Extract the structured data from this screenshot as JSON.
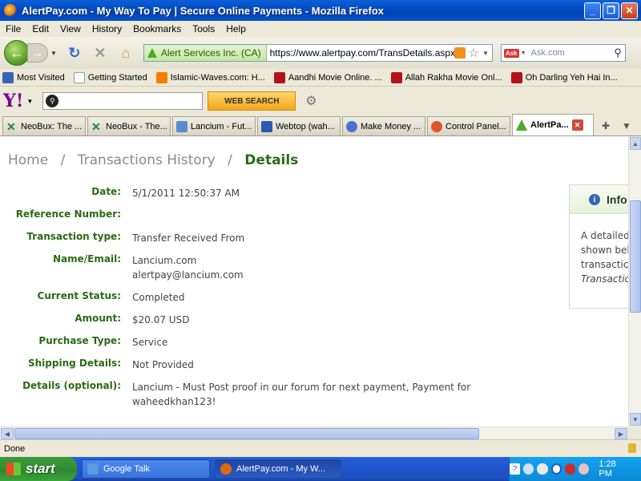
{
  "window": {
    "title": "AlertPay.com - My Way To Pay | Secure Online Payments - Mozilla Firefox"
  },
  "menu": [
    "File",
    "Edit",
    "View",
    "History",
    "Bookmarks",
    "Tools",
    "Help"
  ],
  "nav": {
    "site_identity": "Alert Services Inc. (CA)",
    "url": "https://www.alertpay.com/TransDetails.aspx?A",
    "search_placeholder": "Ask.com",
    "search_engine_logo": "Ask"
  },
  "bookmarks": [
    {
      "label": "Most Visited",
      "icon": "most-visited-icon",
      "color": "#3466b4"
    },
    {
      "label": "Getting Started",
      "icon": "page-icon",
      "color": "#ffffff"
    },
    {
      "label": "Islamic-Waves.com: H...",
      "icon": "blogger-icon",
      "color": "#f57d00"
    },
    {
      "label": "Aandhi Movie Online. ...",
      "icon": "movie-icon",
      "color": "#b3121a"
    },
    {
      "label": "Allah Rakha Movie Onl...",
      "icon": "movie-icon",
      "color": "#b3121a"
    },
    {
      "label": "Oh Darling Yeh Hai In...",
      "icon": "movie-icon",
      "color": "#b3121a"
    }
  ],
  "yahoo": {
    "logo": "Y!",
    "search_button": "WEB SEARCH"
  },
  "tabs": [
    {
      "label": "NeoBux: The ...",
      "icon": "neobux-icon",
      "color": "#1a8a3a",
      "active": false
    },
    {
      "label": "NeoBux - The...",
      "icon": "neobux-icon",
      "color": "#1a8a3a",
      "active": false
    },
    {
      "label": "Lancium - Fut...",
      "icon": "lancium-icon",
      "color": "#5a8ad0",
      "active": false
    },
    {
      "label": "Webtop (wah...",
      "icon": "webtop-icon",
      "color": "#2c5ab0",
      "active": false
    },
    {
      "label": "Make Money ...",
      "icon": "money-icon",
      "color": "#4a74cc",
      "active": false
    },
    {
      "label": "Control Panel...",
      "icon": "control-panel-icon",
      "color": "#e0552c",
      "active": false
    },
    {
      "label": "AlertPa...",
      "icon": "alertpay-icon",
      "color": "#4caa28",
      "active": true
    }
  ],
  "page": {
    "breadcrumb": {
      "home": "Home",
      "sep1": "/",
      "history": "Transactions History",
      "sep2": "/",
      "current": "Details"
    },
    "fields": [
      {
        "label": "Date:",
        "value": "5/1/2011 12:50:37 AM"
      },
      {
        "label": "Reference Number:",
        "value": ""
      },
      {
        "label": "Transaction type:",
        "value": "Transfer Received From"
      },
      {
        "label": "Name/Email:",
        "value": "Lancium.com",
        "value2": "alertpay@lancium.com"
      },
      {
        "label": "Current Status:",
        "value": "Completed"
      },
      {
        "label": "Amount:",
        "value": "$20.07 USD"
      },
      {
        "label": "Purchase Type:",
        "value": "Service"
      },
      {
        "label": "Shipping Details:",
        "value": "Not Provided"
      },
      {
        "label": "Details (optional):",
        "value": "Lancium - Must Post proof in our forum for next payment, Payment for",
        "value2": "waheedkhan123!"
      }
    ],
    "infobox": {
      "title": "Info",
      "lines": [
        "A detailed",
        "shown bel",
        "transactic",
        "Transactic"
      ]
    }
  },
  "status": {
    "text": "Done"
  },
  "taskbar": {
    "start": "start",
    "items": [
      {
        "label": "Google Talk",
        "icon": "google-talk-icon",
        "color": "#5a9ae0"
      },
      {
        "label": "AlertPay.com - My W...",
        "icon": "firefox-icon",
        "color": "#e06a10"
      }
    ],
    "clock": "1:28 PM"
  }
}
